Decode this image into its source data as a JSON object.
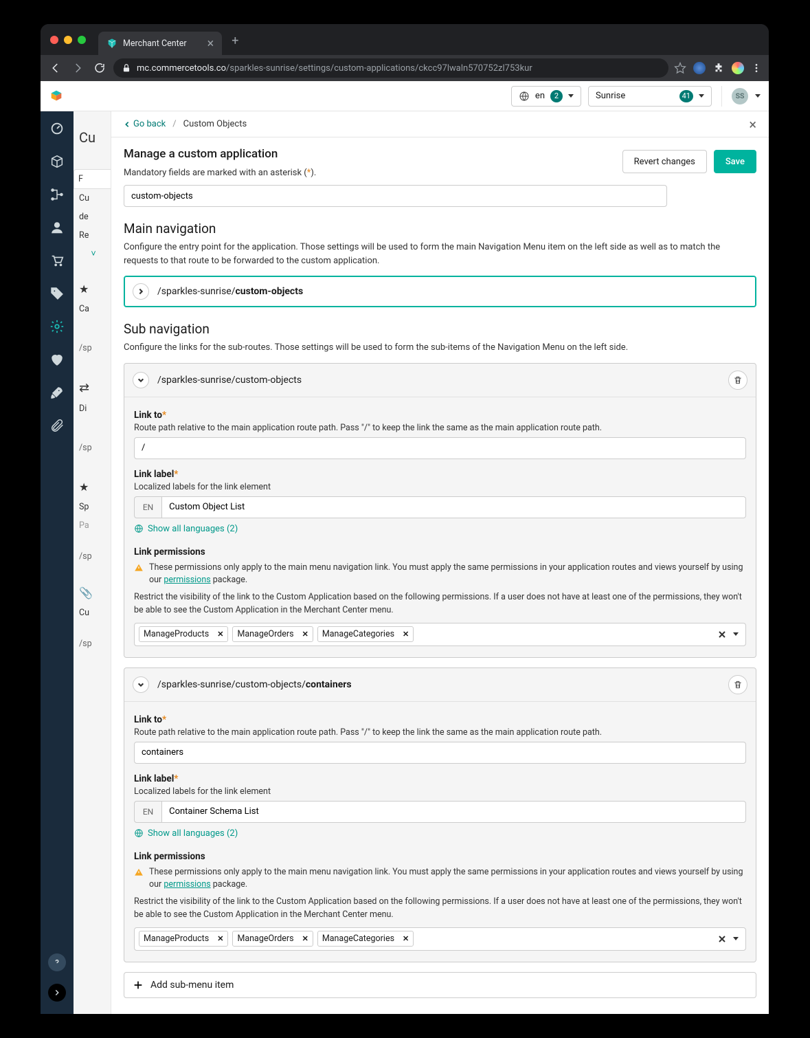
{
  "browser": {
    "tab_title": "Merchant Center",
    "url_host": "mc.commercetools.co",
    "url_path": "/sparkles-sunrise/settings/custom-applications/ckcc97lwaln570752zl753kur"
  },
  "topbar": {
    "lang": "en",
    "lang_badge": "2",
    "project": "Sunrise",
    "project_badge": "41",
    "avatar": "SS"
  },
  "background": {
    "l1": "Cu",
    "l2": "Cu",
    "l3": "de",
    "l4": "Re",
    "l5": "Ca",
    "l6": "/sp",
    "l7": "Di",
    "l8": "/sp",
    "l9": "Sp",
    "l10": "Pa",
    "l11": "/sp",
    "l12": "Cu",
    "l13": "/sp"
  },
  "breadcrumb": {
    "goback": "Go back",
    "current": "Custom Objects"
  },
  "header": {
    "title": "Manage a custom application",
    "mandatory_prefix": "Mandatory fields are marked with an asterisk (",
    "mandatory_ast": "*",
    "mandatory_suffix": ").",
    "revert": "Revert changes",
    "save": "Save"
  },
  "top_input_value": "custom-objects",
  "mainnav": {
    "title": "Main navigation",
    "desc": "Configure the entry point for the application. Those settings will be used to form the main Navigation Menu item on the left side as well as to match the requests to that route to be forwarded to the custom application.",
    "path_prefix": "/sparkles-sunrise/",
    "path_bold": "custom-objects"
  },
  "subnav": {
    "title": "Sub navigation",
    "desc": "Configure the links for the sub-routes. Those settings will be used to form the sub-items of the Navigation Menu on the left side."
  },
  "labels": {
    "link_to": "Link to",
    "link_to_help": "Route path relative to the main application route path. Pass \"/\" to keep the link the same as the main application route path.",
    "link_label": "Link label",
    "link_label_help": "Localized labels for the link element",
    "lang_tag": "EN",
    "show_all": "Show all languages (2)",
    "link_perms": "Link permissions",
    "warn_text1": "These permissions only apply to the main menu navigation link. You must apply the same permissions in your application routes and views yourself by using our ",
    "warn_link": "permissions",
    "warn_text2": " package.",
    "perm_desc": "Restrict the visibility of the link to the Custom Application based on the following permissions. If a user does not have at least one of the permissions, they won't be able to see the Custom Application in the Merchant Center menu.",
    "perm1": "ManageProducts",
    "perm2": "ManageOrders",
    "perm3": "ManageCategories",
    "add_sub": "Add sub-menu item"
  },
  "sub1": {
    "path": "/sparkles-sunrise/custom-objects",
    "link_to": "/",
    "label": "Custom Object List"
  },
  "sub2": {
    "path_prefix": "/sparkles-sunrise/custom-objects/",
    "path_bold": "containers",
    "link_to": "containers",
    "label": "Container Schema List"
  }
}
